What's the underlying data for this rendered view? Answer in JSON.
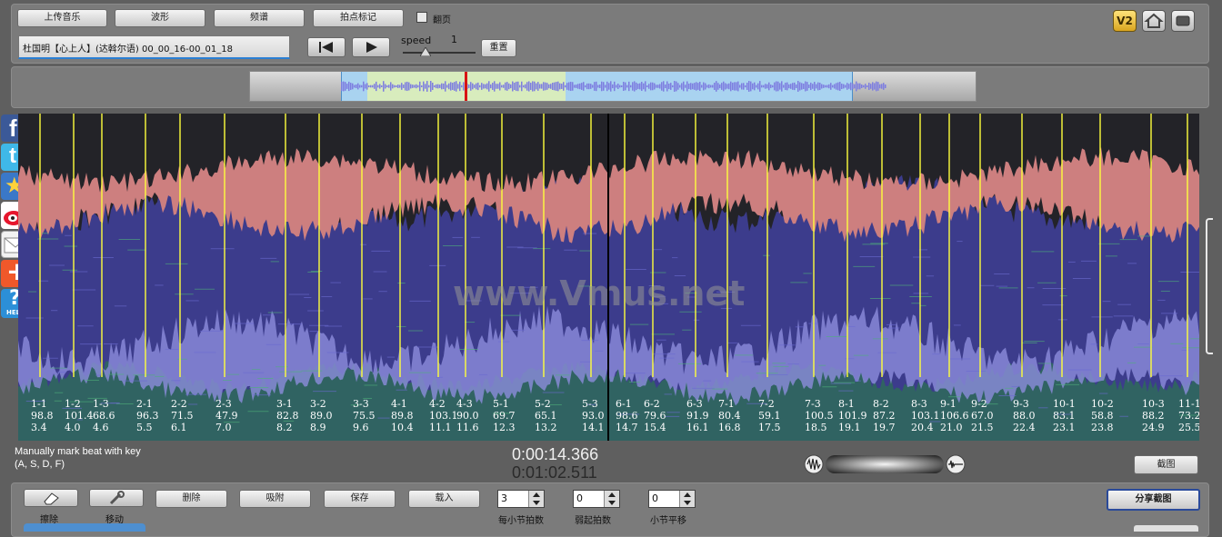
{
  "toolbar": {
    "upload_label": "上传音乐",
    "waveform_label": "波形",
    "spectrum_label": "频谱",
    "tap_mark_label": "拍点标记",
    "flip_label": "翻页",
    "song_title": "杜国明【心上人】(达斡尔语) 00_00_16-00_01_18",
    "speed_label": "speed",
    "speed_value": "1",
    "reset_label": "重置",
    "version_badge": "V2"
  },
  "watermark": "www.Vmus.net",
  "beats": [
    {
      "label": "1-1",
      "bpm": "98.8",
      "time": "3.4"
    },
    {
      "label": "1-2",
      "bpm": "101.4",
      "time": "4.0"
    },
    {
      "label": "1-3",
      "bpm": "68.6",
      "time": "4.6"
    },
    {
      "label": "2-1",
      "bpm": "96.3",
      "time": "5.5"
    },
    {
      "label": "2-2",
      "bpm": "71.5",
      "time": "6.1"
    },
    {
      "label": "2-3",
      "bpm": "47.9",
      "time": "7.0"
    },
    {
      "label": "3-1",
      "bpm": "82.8",
      "time": "8.2"
    },
    {
      "label": "3-2",
      "bpm": "89.0",
      "time": "8.9"
    },
    {
      "label": "3-3",
      "bpm": "75.5",
      "time": "9.6"
    },
    {
      "label": "4-1",
      "bpm": "89.8",
      "time": "10.4"
    },
    {
      "label": "4-2",
      "bpm": "103.1",
      "time": "11.1"
    },
    {
      "label": "4-3",
      "bpm": "90.0",
      "time": "11.6"
    },
    {
      "label": "5-1",
      "bpm": "69.7",
      "time": "12.3"
    },
    {
      "label": "5-2",
      "bpm": "65.1",
      "time": "13.2"
    },
    {
      "label": "5-3",
      "bpm": "93.0",
      "time": "14.1"
    },
    {
      "label": "6-1",
      "bpm": "98.6",
      "time": "14.7"
    },
    {
      "label": "6-2",
      "bpm": "79.6",
      "time": "15.4"
    },
    {
      "label": "6-3",
      "bpm": "91.9",
      "time": "16.1"
    },
    {
      "label": "7-1",
      "bpm": "80.4",
      "time": "16.8"
    },
    {
      "label": "7-2",
      "bpm": "59.1",
      "time": "17.5"
    },
    {
      "label": "7-3",
      "bpm": "100.5",
      "time": "18.5"
    },
    {
      "label": "8-1",
      "bpm": "101.9",
      "time": "19.1"
    },
    {
      "label": "8-2",
      "bpm": "87.2",
      "time": "19.7"
    },
    {
      "label": "8-3",
      "bpm": "103.1",
      "time": "20.4"
    },
    {
      "label": "9-1",
      "bpm": "106.6",
      "time": "21.0"
    },
    {
      "label": "9-2",
      "bpm": "67.0",
      "time": "21.5"
    },
    {
      "label": "9-3",
      "bpm": "88.0",
      "time": "22.4"
    },
    {
      "label": "10-1",
      "bpm": "83.1",
      "time": "23.1"
    },
    {
      "label": "10-2",
      "bpm": "58.8",
      "time": "23.8"
    },
    {
      "label": "10-3",
      "bpm": "88.2",
      "time": "24.9"
    },
    {
      "label": "11-1",
      "bpm": "73.2",
      "time": "25.5"
    }
  ],
  "status": {
    "hint_line1": "Manually mark beat with key",
    "hint_line2": "(A, S, D, F)",
    "current_time": "0:00:14.366",
    "total_time": "0:01:02.511",
    "screenshot_label": "截图"
  },
  "bottom": {
    "erase_label": "擦除",
    "move_label": "移动",
    "delete_label": "删除",
    "snap_label": "吸附",
    "save_label": "保存",
    "load_label": "载入",
    "beats_per_bar_value": "3",
    "beats_per_bar_label": "每小节拍数",
    "pickup_value": "0",
    "pickup_label": "弱起拍数",
    "bar_shift_value": "0",
    "bar_shift_label": "小节平移",
    "share_label": "分享截图"
  },
  "colors": {
    "panel": "#7b7b7b",
    "beat_line": "#ffff3c",
    "spectrum_pink": "#cd7f7f",
    "spectrum_blue": "#3c3c8c",
    "spectrum_lavender": "#8c8cdc",
    "playhead": "#000000"
  }
}
